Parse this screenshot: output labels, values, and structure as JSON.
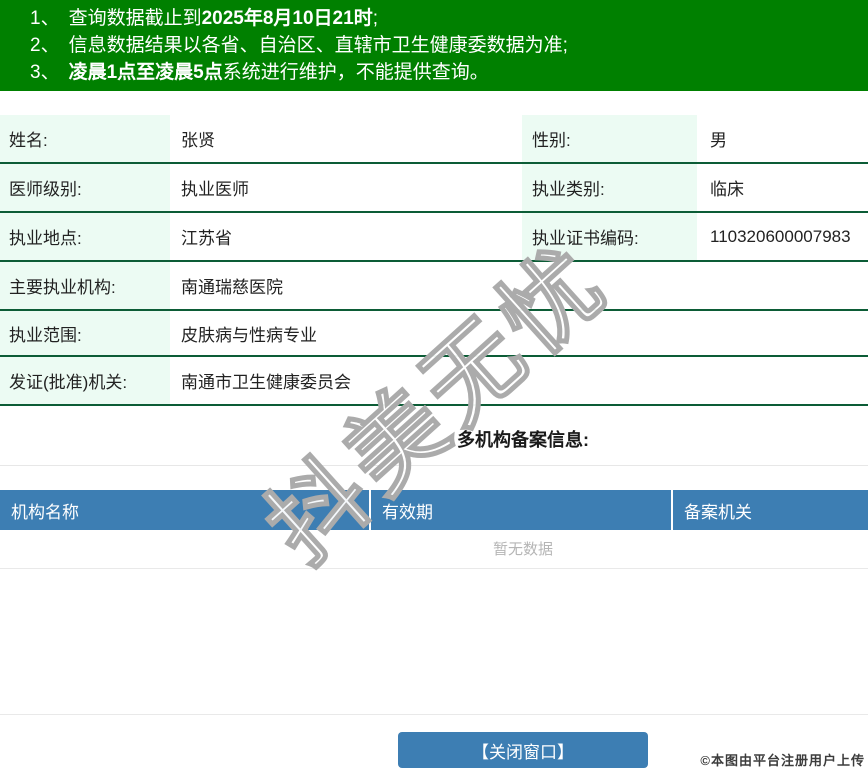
{
  "notices": {
    "items": [
      {
        "num": "1、",
        "pre": "查询数据截止到",
        "bold": "2025年8月10日21时",
        "post": ";"
      },
      {
        "num": "2、",
        "pre": "信息数据结果以各省、自治区、直辖市卫生健康委数据为准;",
        "bold": "",
        "post": ""
      },
      {
        "num": "3、",
        "pre": "",
        "bold": "凌晨1点至凌晨5点",
        "post": "系统进行维护，不能提供查询。"
      }
    ]
  },
  "info": {
    "rows": [
      {
        "label1": "姓名:",
        "value1": "张贤",
        "label2": "性别:",
        "value2": "男"
      },
      {
        "label1": "医师级别:",
        "value1": "执业医师",
        "label2": "执业类别:",
        "value2": "临床"
      },
      {
        "label1": "执业地点:",
        "value1": "江苏省",
        "label2": "执业证书编码:",
        "value2": "110320600007983"
      },
      {
        "label1": "主要执业机构:",
        "value1": "南通瑞慈医院"
      },
      {
        "label1": "执业范围:",
        "value1": "皮肤病与性病专业"
      },
      {
        "label1": "发证(批准)机关:",
        "value1": "南通市卫生健康委员会"
      }
    ]
  },
  "section": {
    "title": "多机构备案信息:"
  },
  "record_table": {
    "headers": [
      "机构名称",
      "有效期",
      "备案机关"
    ],
    "empty_text": "暂无数据"
  },
  "footer": {
    "close_button": "【关闭窗口】",
    "copyright": "©本图由平台注册用户上传"
  },
  "watermark": {
    "text": "抖美无忧"
  },
  "colors": {
    "banner_green": "#008000",
    "row_border_green": "#0c5c36",
    "label_mint": "#ecfbf3",
    "header_blue": "#3d7eb3",
    "empty_text_gray": "#b5b5b5"
  }
}
